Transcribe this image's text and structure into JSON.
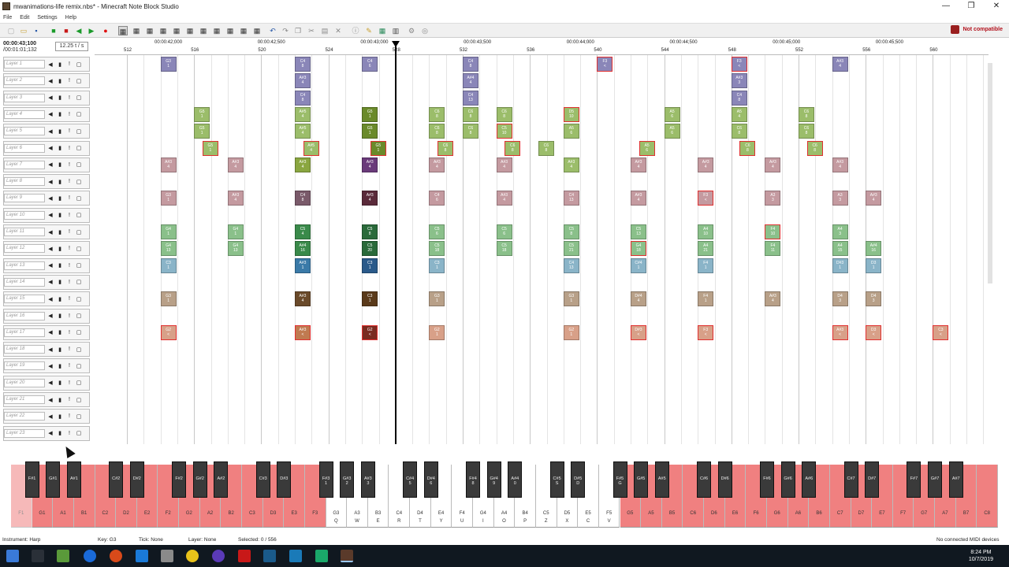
{
  "window": {
    "title": "mwanimations-life remix.nbs* - Minecraft Note Block Studio",
    "controls": [
      "—",
      "❐",
      "✕"
    ]
  },
  "menu": [
    "File",
    "Edit",
    "Settings",
    "Help"
  ],
  "toolbar": {
    "compat_label": "Not compatible"
  },
  "time": {
    "elapsed": "00:00:43;100",
    "total": "/00:01:01;132",
    "tempo": "12.25 t / s"
  },
  "layers": [
    "Layer 1",
    "Layer 2",
    "Layer 3",
    "Layer 4",
    "Layer 5",
    "Layer 6",
    "Layer 7",
    "Layer 8",
    "Layer 9",
    "Layer 10",
    "Layer 11",
    "Layer 12",
    "Layer 13",
    "Layer 14",
    "Layer 15",
    "Layer 16",
    "Layer 17",
    "Layer 18",
    "Layer 19",
    "Layer 20",
    "Layer 21",
    "Layer 22",
    "Layer 23"
  ],
  "ruler": {
    "times": [
      "00:00:42;000",
      "00:00:42;500",
      "00:00:43;000",
      "00:00:43;500",
      "00:00:44;000",
      "00:00:44;500",
      "00:00:45;000",
      "00:00:45;500"
    ],
    "bars": [
      "512",
      "516",
      "520",
      "524",
      "528",
      "532",
      "536",
      "540",
      "544",
      "548",
      "552",
      "556",
      "560"
    ]
  },
  "notes": [
    {
      "t": 4,
      "l": 0,
      "n": "G3",
      "k": "1",
      "c": "#8a86b8",
      "r": false
    },
    {
      "t": 20,
      "l": 0,
      "n": "C4",
      "k": "8",
      "c": "#8a86b8",
      "r": false
    },
    {
      "t": 28,
      "l": 0,
      "n": "C4",
      "k": "6",
      "c": "#8a86b8",
      "r": false
    },
    {
      "t": 40,
      "l": 0,
      "n": "C4",
      "k": "8",
      "c": "#8a86b8",
      "r": false
    },
    {
      "t": 56,
      "l": 0,
      "n": "F3",
      "k": "<",
      "c": "#8a86b8",
      "r": true
    },
    {
      "t": 72,
      "l": 0,
      "n": "F3",
      "k": "<",
      "c": "#8a86b8",
      "r": true
    },
    {
      "t": 84,
      "l": 0,
      "n": "A#3",
      "k": "4",
      "c": "#8a86b8",
      "r": false
    },
    {
      "t": 20,
      "l": 1,
      "n": "A#3",
      "k": "4",
      "c": "#8a86b8",
      "r": false
    },
    {
      "t": 40,
      "l": 1,
      "n": "A#4",
      "k": "4",
      "c": "#8a86b8",
      "r": false
    },
    {
      "t": 72,
      "l": 1,
      "n": "A#3",
      "k": "3",
      "c": "#8a86b8",
      "r": false
    },
    {
      "t": 20,
      "l": 2,
      "n": "C4",
      "k": "8",
      "c": "#8a86b8",
      "r": false
    },
    {
      "t": 40,
      "l": 2,
      "n": "C4",
      "k": "13",
      "c": "#8a86b8",
      "r": false
    },
    {
      "t": 72,
      "l": 2,
      "n": "C4",
      "k": "8",
      "c": "#8a86b8",
      "r": false
    },
    {
      "t": 8,
      "l": 3,
      "n": "G5",
      "k": "1",
      "c": "#9bbd6a",
      "r": false
    },
    {
      "t": 20,
      "l": 3,
      "n": "A#5",
      "k": "4",
      "c": "#9bbd6a",
      "r": false
    },
    {
      "t": 28,
      "l": 3,
      "n": "G5",
      "k": "1",
      "c": "#6a8a2a",
      "r": false
    },
    {
      "t": 36,
      "l": 3,
      "n": "C6",
      "k": "8",
      "c": "#9bbd6a",
      "r": false
    },
    {
      "t": 40,
      "l": 3,
      "n": "C6",
      "k": "8",
      "c": "#9bbd6a",
      "r": false
    },
    {
      "t": 44,
      "l": 3,
      "n": "C6",
      "k": "8",
      "c": "#9bbd6a",
      "r": false
    },
    {
      "t": 52,
      "l": 3,
      "n": "D5",
      "k": "10",
      "c": "#9bbd6a",
      "r": true
    },
    {
      "t": 64,
      "l": 3,
      "n": "A5",
      "k": "6",
      "c": "#9bbd6a",
      "r": false
    },
    {
      "t": 72,
      "l": 3,
      "n": "A5",
      "k": "4",
      "c": "#9bbd6a",
      "r": false
    },
    {
      "t": 80,
      "l": 3,
      "n": "C6",
      "k": "8",
      "c": "#9bbd6a",
      "r": false
    },
    {
      "t": 8,
      "l": 4,
      "n": "G5",
      "k": "1",
      "c": "#9bbd6a",
      "r": false
    },
    {
      "t": 20,
      "l": 4,
      "n": "A#5",
      "k": "4",
      "c": "#9bbd6a",
      "r": false
    },
    {
      "t": 28,
      "l": 4,
      "n": "G5",
      "k": "1",
      "c": "#6a8a2a",
      "r": false
    },
    {
      "t": 36,
      "l": 4,
      "n": "C6",
      "k": "8",
      "c": "#9bbd6a",
      "r": false
    },
    {
      "t": 40,
      "l": 4,
      "n": "C6",
      "k": "8",
      "c": "#9bbd6a",
      "r": false
    },
    {
      "t": 44,
      "l": 4,
      "n": "C5",
      "k": "10",
      "c": "#9bbd6a",
      "r": true
    },
    {
      "t": 52,
      "l": 4,
      "n": "A5",
      "k": "6",
      "c": "#9bbd6a",
      "r": false
    },
    {
      "t": 64,
      "l": 4,
      "n": "A5",
      "k": "6",
      "c": "#9bbd6a",
      "r": false
    },
    {
      "t": 72,
      "l": 4,
      "n": "C6",
      "k": "8",
      "c": "#9bbd6a",
      "r": false
    },
    {
      "t": 80,
      "l": 4,
      "n": "C6",
      "k": "8",
      "c": "#9bbd6a",
      "r": false
    },
    {
      "t": 9,
      "l": 5,
      "n": "G5",
      "k": "1",
      "c": "#9bbd6a",
      "r": true
    },
    {
      "t": 21,
      "l": 5,
      "n": "A#5",
      "k": "4",
      "c": "#9bbd6a",
      "r": true
    },
    {
      "t": 29,
      "l": 5,
      "n": "G5",
      "k": "1",
      "c": "#6a8a2a",
      "r": true
    },
    {
      "t": 37,
      "l": 5,
      "n": "C6",
      "k": "8",
      "c": "#9bbd6a",
      "r": true
    },
    {
      "t": 45,
      "l": 5,
      "n": "C6",
      "k": "8",
      "c": "#9bbd6a",
      "r": true
    },
    {
      "t": 49,
      "l": 5,
      "n": "C6",
      "k": "8",
      "c": "#9bbd6a",
      "r": false
    },
    {
      "t": 61,
      "l": 5,
      "n": "A5",
      "k": "6",
      "c": "#9bbd6a",
      "r": true
    },
    {
      "t": 73,
      "l": 5,
      "n": "C6",
      "k": "8",
      "c": "#9bbd6a",
      "r": true
    },
    {
      "t": 81,
      "l": 5,
      "n": "C6",
      "k": "8",
      "c": "#9bbd6a",
      "r": true
    },
    {
      "t": 4,
      "l": 6,
      "n": "A#3",
      "k": "4",
      "c": "#c49aa0",
      "r": false
    },
    {
      "t": 12,
      "l": 6,
      "n": "A#3",
      "k": "4",
      "c": "#c49aa0",
      "r": false
    },
    {
      "t": 20,
      "l": 6,
      "n": "A#3",
      "k": "4",
      "c": "#8aa640",
      "r": false
    },
    {
      "t": 28,
      "l": 6,
      "n": "A#3",
      "k": "4",
      "c": "#6a3a7a",
      "r": false
    },
    {
      "t": 36,
      "l": 6,
      "n": "A#3",
      "k": "4",
      "c": "#c49aa0",
      "r": false
    },
    {
      "t": 44,
      "l": 6,
      "n": "A#3",
      "k": "4",
      "c": "#c49aa0",
      "r": false
    },
    {
      "t": 52,
      "l": 6,
      "n": "A#3",
      "k": "4",
      "c": "#9bbd6a",
      "r": false
    },
    {
      "t": 60,
      "l": 6,
      "n": "A#3",
      "k": "4",
      "c": "#c49aa0",
      "r": false
    },
    {
      "t": 68,
      "l": 6,
      "n": "A#3",
      "k": "4",
      "c": "#c49aa0",
      "r": false
    },
    {
      "t": 76,
      "l": 6,
      "n": "A#3",
      "k": "4",
      "c": "#c49aa0",
      "r": false
    },
    {
      "t": 84,
      "l": 6,
      "n": "A#3",
      "k": "4",
      "c": "#c49aa0",
      "r": false
    },
    {
      "t": 4,
      "l": 8,
      "n": "G3",
      "k": "1",
      "c": "#c49aa0",
      "r": false
    },
    {
      "t": 12,
      "l": 8,
      "n": "A#3",
      "k": "4",
      "c": "#c49aa0",
      "r": false
    },
    {
      "t": 20,
      "l": 8,
      "n": "C4",
      "k": "8",
      "c": "#7a5a6a",
      "r": false
    },
    {
      "t": 28,
      "l": 8,
      "n": "A#3",
      "k": "4",
      "c": "#5a2a3a",
      "r": false
    },
    {
      "t": 36,
      "l": 8,
      "n": "C4",
      "k": "6",
      "c": "#c49aa0",
      "r": false
    },
    {
      "t": 44,
      "l": 8,
      "n": "A#3",
      "k": "4",
      "c": "#c49aa0",
      "r": false
    },
    {
      "t": 52,
      "l": 8,
      "n": "C4",
      "k": "13",
      "c": "#c49aa0",
      "r": false
    },
    {
      "t": 60,
      "l": 8,
      "n": "A#3",
      "k": "4",
      "c": "#c49aa0",
      "r": false
    },
    {
      "t": 68,
      "l": 8,
      "n": "F3",
      "k": "<",
      "c": "#c49aa0",
      "r": true
    },
    {
      "t": 76,
      "l": 8,
      "n": "A3",
      "k": "3",
      "c": "#c49aa0",
      "r": false
    },
    {
      "t": 84,
      "l": 8,
      "n": "A3",
      "k": "3",
      "c": "#c49aa0",
      "r": false
    },
    {
      "t": 88,
      "l": 8,
      "n": "A#3",
      "k": "4",
      "c": "#c49aa0",
      "r": false
    },
    {
      "t": 4,
      "l": 10,
      "n": "G4",
      "k": "1",
      "c": "#8ac08a",
      "r": false
    },
    {
      "t": 12,
      "l": 10,
      "n": "G4",
      "k": "1",
      "c": "#8ac08a",
      "r": false
    },
    {
      "t": 20,
      "l": 10,
      "n": "C5",
      "k": "4",
      "c": "#3a8a4a",
      "r": false
    },
    {
      "t": 28,
      "l": 10,
      "n": "C5",
      "k": "8",
      "c": "#2a6a3a",
      "r": false
    },
    {
      "t": 36,
      "l": 10,
      "n": "C5",
      "k": "6",
      "c": "#8ac08a",
      "r": false
    },
    {
      "t": 44,
      "l": 10,
      "n": "C5",
      "k": "6",
      "c": "#8ac08a",
      "r": false
    },
    {
      "t": 52,
      "l": 10,
      "n": "C5",
      "k": "8",
      "c": "#8ac08a",
      "r": false
    },
    {
      "t": 60,
      "l": 10,
      "n": "C5",
      "k": "13",
      "c": "#8ac08a",
      "r": false
    },
    {
      "t": 68,
      "l": 10,
      "n": "A4",
      "k": "10",
      "c": "#8ac08a",
      "r": false
    },
    {
      "t": 76,
      "l": 10,
      "n": "F4",
      "k": "10",
      "c": "#8ac08a",
      "r": true
    },
    {
      "t": 84,
      "l": 10,
      "n": "A4",
      "k": "3",
      "c": "#8ac08a",
      "r": false
    },
    {
      "t": 4,
      "l": 11,
      "n": "G4",
      "k": "13",
      "c": "#8ac08a",
      "r": false
    },
    {
      "t": 12,
      "l": 11,
      "n": "G4",
      "k": "13",
      "c": "#8ac08a",
      "r": false
    },
    {
      "t": 20,
      "l": 11,
      "n": "A#4",
      "k": "16",
      "c": "#3a8a4a",
      "r": false
    },
    {
      "t": 28,
      "l": 11,
      "n": "C5",
      "k": "20",
      "c": "#2a6a3a",
      "r": false
    },
    {
      "t": 36,
      "l": 11,
      "n": "C5",
      "k": "18",
      "c": "#8ac08a",
      "r": false
    },
    {
      "t": 44,
      "l": 11,
      "n": "C5",
      "k": "18",
      "c": "#8ac08a",
      "r": false
    },
    {
      "t": 52,
      "l": 11,
      "n": "C5",
      "k": "21",
      "c": "#8ac08a",
      "r": false
    },
    {
      "t": 60,
      "l": 11,
      "n": "G4",
      "k": "18",
      "c": "#8ac08a",
      "r": true
    },
    {
      "t": 68,
      "l": 11,
      "n": "A4",
      "k": "21",
      "c": "#8ac08a",
      "r": false
    },
    {
      "t": 76,
      "l": 11,
      "n": "F4",
      "k": "11",
      "c": "#8ac08a",
      "r": false
    },
    {
      "t": 84,
      "l": 11,
      "n": "A4",
      "k": "15",
      "c": "#8ac08a",
      "r": false
    },
    {
      "t": 88,
      "l": 11,
      "n": "A#4",
      "k": "16",
      "c": "#8ac08a",
      "r": false
    },
    {
      "t": 4,
      "l": 12,
      "n": "C3",
      "k": "1",
      "c": "#8ab4c8",
      "r": false
    },
    {
      "t": 20,
      "l": 12,
      "n": "A#3",
      "k": "1",
      "c": "#3a7aa8",
      "r": false
    },
    {
      "t": 28,
      "l": 12,
      "n": "C3",
      "k": "1",
      "c": "#2a5a8a",
      "r": false
    },
    {
      "t": 36,
      "l": 12,
      "n": "C3",
      "k": "1",
      "c": "#8ab4c8",
      "r": false
    },
    {
      "t": 52,
      "l": 12,
      "n": "C4",
      "k": "13",
      "c": "#8ab4c8",
      "r": false
    },
    {
      "t": 60,
      "l": 12,
      "n": "C#4",
      "k": "1",
      "c": "#8ab4c8",
      "r": false
    },
    {
      "t": 68,
      "l": 12,
      "n": "F4",
      "k": "1",
      "c": "#8ab4c8",
      "r": false
    },
    {
      "t": 84,
      "l": 12,
      "n": "D#3",
      "k": "1",
      "c": "#8ab4c8",
      "r": false
    },
    {
      "t": 88,
      "l": 12,
      "n": "D3",
      "k": "1",
      "c": "#8ab4c8",
      "r": false
    },
    {
      "t": 4,
      "l": 14,
      "n": "G3",
      "k": "1",
      "c": "#b8a088",
      "r": false
    },
    {
      "t": 20,
      "l": 14,
      "n": "A#3",
      "k": "4",
      "c": "#6a4a2a",
      "r": false
    },
    {
      "t": 28,
      "l": 14,
      "n": "C3",
      "k": "1",
      "c": "#5a3a1a",
      "r": false
    },
    {
      "t": 36,
      "l": 14,
      "n": "G3",
      "k": "1",
      "c": "#b8a088",
      "r": false
    },
    {
      "t": 52,
      "l": 14,
      "n": "G3",
      "k": "1",
      "c": "#b8a088",
      "r": false
    },
    {
      "t": 60,
      "l": 14,
      "n": "D#4",
      "k": "4",
      "c": "#b8a088",
      "r": false
    },
    {
      "t": 68,
      "l": 14,
      "n": "F4",
      "k": "1",
      "c": "#b8a088",
      "r": false
    },
    {
      "t": 76,
      "l": 14,
      "n": "A#3",
      "k": "4",
      "c": "#b8a088",
      "r": false
    },
    {
      "t": 84,
      "l": 14,
      "n": "D4",
      "k": "3",
      "c": "#b8a088",
      "r": false
    },
    {
      "t": 88,
      "l": 14,
      "n": "D4",
      "k": "3",
      "c": "#b8a088",
      "r": false
    },
    {
      "t": 4,
      "l": 16,
      "n": "G2",
      "k": "<",
      "c": "#d8a088",
      "r": true
    },
    {
      "t": 20,
      "l": 16,
      "n": "A#3",
      "k": "<",
      "c": "#c07a50",
      "r": true
    },
    {
      "t": 28,
      "l": 16,
      "n": "G2",
      "k": "<",
      "c": "#7a2a20",
      "r": true
    },
    {
      "t": 36,
      "l": 16,
      "n": "G2",
      "k": "1",
      "c": "#d8a088",
      "r": false
    },
    {
      "t": 52,
      "l": 16,
      "n": "G2",
      "k": "1",
      "c": "#d8a088",
      "r": false
    },
    {
      "t": 60,
      "l": 16,
      "n": "D#3",
      "k": "<",
      "c": "#d8a088",
      "r": true
    },
    {
      "t": 68,
      "l": 16,
      "n": "F3",
      "k": "<",
      "c": "#d8a088",
      "r": true
    },
    {
      "t": 84,
      "l": 16,
      "n": "A#3",
      "k": "<",
      "c": "#d8a088",
      "r": true
    },
    {
      "t": 88,
      "l": 16,
      "n": "D3",
      "k": "<",
      "c": "#d8a088",
      "r": true
    },
    {
      "t": 96,
      "l": 16,
      "n": "C3",
      "k": "<",
      "c": "#d8a088",
      "r": true
    }
  ],
  "piano": {
    "white": [
      {
        "n": "F1",
        "k": ""
      },
      {
        "n": "G1",
        "k": ""
      },
      {
        "n": "A1",
        "k": ""
      },
      {
        "n": "B1",
        "k": ""
      },
      {
        "n": "C2",
        "k": ""
      },
      {
        "n": "D2",
        "k": ""
      },
      {
        "n": "E2",
        "k": ""
      },
      {
        "n": "F2",
        "k": ""
      },
      {
        "n": "G2",
        "k": ""
      },
      {
        "n": "A2",
        "k": ""
      },
      {
        "n": "B2",
        "k": ""
      },
      {
        "n": "C3",
        "k": ""
      },
      {
        "n": "D3",
        "k": ""
      },
      {
        "n": "E3",
        "k": ""
      },
      {
        "n": "F3",
        "k": ""
      },
      {
        "n": "G3",
        "k": "Q"
      },
      {
        "n": "A3",
        "k": "W"
      },
      {
        "n": "B3",
        "k": "E"
      },
      {
        "n": "C4",
        "k": "R"
      },
      {
        "n": "D4",
        "k": "T"
      },
      {
        "n": "E4",
        "k": "Y"
      },
      {
        "n": "F4",
        "k": "U"
      },
      {
        "n": "G4",
        "k": "I"
      },
      {
        "n": "A4",
        "k": "O"
      },
      {
        "n": "B4",
        "k": "P"
      },
      {
        "n": "C5",
        "k": "Z"
      },
      {
        "n": "D5",
        "k": "X"
      },
      {
        "n": "E5",
        "k": "C"
      },
      {
        "n": "F5",
        "k": "V"
      },
      {
        "n": "G5",
        "k": ""
      },
      {
        "n": "A5",
        "k": ""
      },
      {
        "n": "B5",
        "k": ""
      },
      {
        "n": "C6",
        "k": ""
      },
      {
        "n": "D6",
        "k": ""
      },
      {
        "n": "E6",
        "k": ""
      },
      {
        "n": "F6",
        "k": ""
      },
      {
        "n": "G6",
        "k": ""
      },
      {
        "n": "A6",
        "k": ""
      },
      {
        "n": "B6",
        "k": ""
      },
      {
        "n": "C7",
        "k": ""
      },
      {
        "n": "D7",
        "k": ""
      },
      {
        "n": "E7",
        "k": ""
      },
      {
        "n": "F7",
        "k": ""
      },
      {
        "n": "G7",
        "k": ""
      },
      {
        "n": "A7",
        "k": ""
      },
      {
        "n": "B7",
        "k": ""
      },
      {
        "n": "C8",
        "k": ""
      }
    ],
    "black": [
      {
        "after": 0,
        "n": "F#1",
        "k": ""
      },
      {
        "after": 1,
        "n": "G#1",
        "k": ""
      },
      {
        "after": 2,
        "n": "A#1",
        "k": ""
      },
      {
        "after": 4,
        "n": "C#2",
        "k": ""
      },
      {
        "after": 5,
        "n": "D#2",
        "k": ""
      },
      {
        "after": 7,
        "n": "F#2",
        "k": ""
      },
      {
        "after": 8,
        "n": "G#2",
        "k": ""
      },
      {
        "after": 9,
        "n": "A#2",
        "k": ""
      },
      {
        "after": 11,
        "n": "C#3",
        "k": ""
      },
      {
        "after": 12,
        "n": "D#3",
        "k": ""
      },
      {
        "after": 14,
        "n": "F#3",
        "k": "1"
      },
      {
        "after": 15,
        "n": "G#3",
        "k": "2"
      },
      {
        "after": 16,
        "n": "A#3",
        "k": "3"
      },
      {
        "after": 18,
        "n": "C#4",
        "k": "5"
      },
      {
        "after": 19,
        "n": "D#4",
        "k": "6"
      },
      {
        "after": 21,
        "n": "F#4",
        "k": "8"
      },
      {
        "after": 22,
        "n": "G#4",
        "k": "9"
      },
      {
        "after": 23,
        "n": "A#4",
        "k": "0"
      },
      {
        "after": 25,
        "n": "C#5",
        "k": "S"
      },
      {
        "after": 26,
        "n": "D#5",
        "k": "D"
      },
      {
        "after": 28,
        "n": "F#5",
        "k": "G"
      },
      {
        "after": 29,
        "n": "G#5",
        "k": ""
      },
      {
        "after": 30,
        "n": "A#5",
        "k": ""
      },
      {
        "after": 32,
        "n": "C#6",
        "k": ""
      },
      {
        "after": 33,
        "n": "D#6",
        "k": ""
      },
      {
        "after": 35,
        "n": "F#6",
        "k": ""
      },
      {
        "after": 36,
        "n": "G#6",
        "k": ""
      },
      {
        "after": 37,
        "n": "A#6",
        "k": ""
      },
      {
        "after": 39,
        "n": "C#7",
        "k": ""
      },
      {
        "after": 40,
        "n": "D#7",
        "k": ""
      },
      {
        "after": 42,
        "n": "F#7",
        "k": ""
      },
      {
        "after": 43,
        "n": "G#7",
        "k": ""
      },
      {
        "after": 44,
        "n": "A#7",
        "k": ""
      }
    ],
    "colors": {
      "outside_range": "#f08080",
      "in_range": "#ffffff"
    }
  },
  "status": {
    "instrument": "Instrument: Harp",
    "key": "Key: G3",
    "tick": "Tick: None",
    "layer": "Layer: None",
    "selected": "Selected: 0 / 556",
    "midi": "No connected MIDI devices"
  },
  "clock": {
    "time": "8:24 PM",
    "date": "10/7/2019"
  }
}
